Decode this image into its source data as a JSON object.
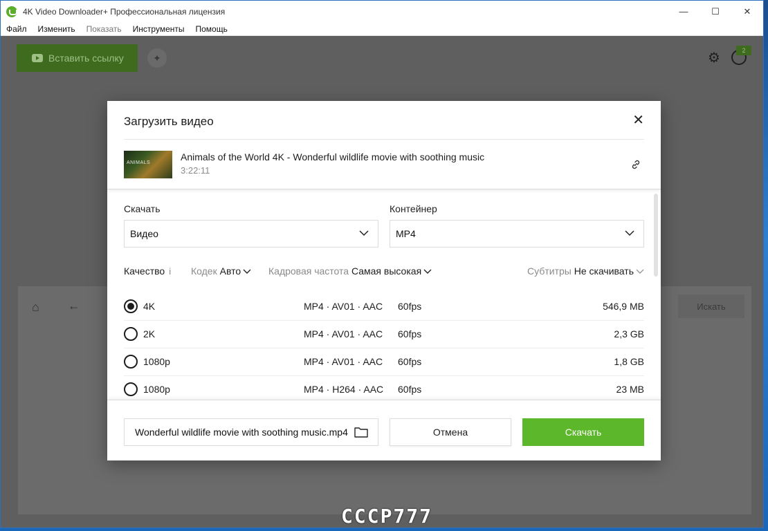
{
  "window": {
    "title": "4K Video Downloader+ Профессиональная лицензия",
    "controls": {
      "minimize": "—",
      "maximize": "☐",
      "close": "✕"
    }
  },
  "menu": {
    "items": [
      {
        "label": "Файл",
        "enabled": true
      },
      {
        "label": "Изменить",
        "enabled": true
      },
      {
        "label": "Показать",
        "enabled": false
      },
      {
        "label": "Инструменты",
        "enabled": true
      },
      {
        "label": "Помощь",
        "enabled": true
      }
    ]
  },
  "toolbar": {
    "paste_label": "Вставить ссылку",
    "account_badge": "2"
  },
  "browser": {
    "search_label": "Искать"
  },
  "dialog": {
    "title": "Загрузить видео",
    "video": {
      "title": "Animals of the World 4K - Wonderful wildlife movie with soothing music",
      "duration": "3:22:11",
      "thumbnail_text": "ANIMALS"
    },
    "download": {
      "label": "Скачать",
      "value": "Видео"
    },
    "container": {
      "label": "Контейнер",
      "value": "MP4"
    },
    "filters": {
      "quality_label": "Качество",
      "codec_label": "Кодек",
      "codec_value": "Авто",
      "framerate_label": "Кадровая частота",
      "framerate_value": "Самая высокая",
      "subtitles_label": "Субтитры",
      "subtitles_value": "Не скачивать"
    },
    "qualities": [
      {
        "label": "4K",
        "format": "MP4 · AV01 · AAC",
        "fps": "60fps",
        "size": "546,9 MB",
        "selected": true
      },
      {
        "label": "2K",
        "format": "MP4 · AV01 · AAC",
        "fps": "60fps",
        "size": "2,3 GB",
        "selected": false
      },
      {
        "label": "1080p",
        "format": "MP4 · AV01 · AAC",
        "fps": "60fps",
        "size": "1,8 GB",
        "selected": false
      },
      {
        "label": "1080p",
        "format": "MP4 · H264 · AAC",
        "fps": "60fps",
        "size": "23 MB",
        "selected": false
      }
    ],
    "filename": "Wonderful wildlife movie with soothing music.mp4",
    "cancel_label": "Отмена",
    "download_label": "Скачать"
  },
  "watermark": "СССР777",
  "colors": {
    "accent": "#5cb82a",
    "dim_overlay": "#5f5f5f"
  }
}
